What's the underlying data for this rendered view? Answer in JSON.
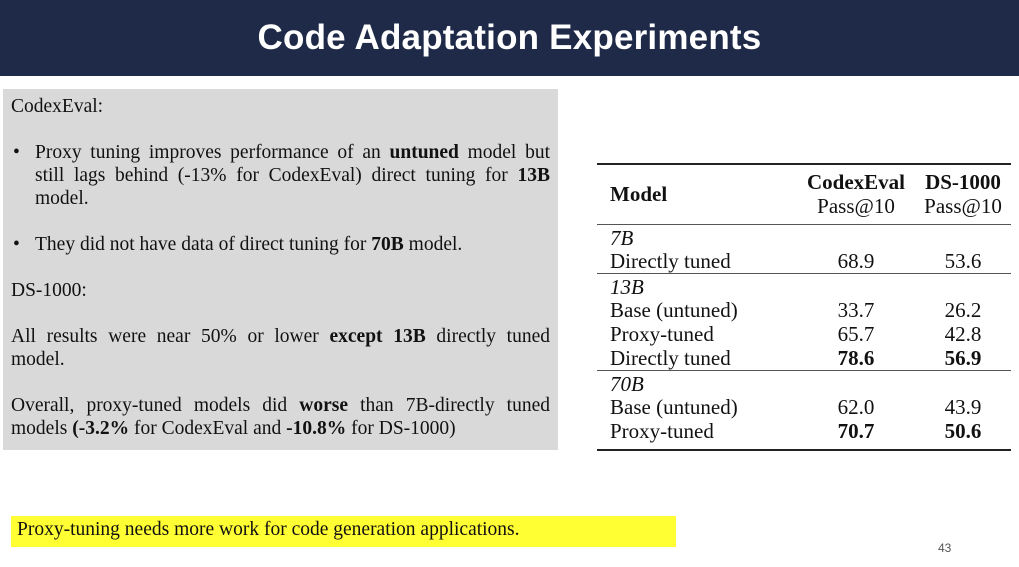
{
  "slide": {
    "title": "Code Adaptation Experiments",
    "page_number": "43"
  },
  "left_panel": {
    "codexeval_label": "CodexEval:",
    "bullet1": {
      "t1": "Proxy tuning improves performance of an ",
      "b1": "untuned",
      "t2": " model but still lags behind (-13% for CodexEval) direct tuning for ",
      "b2": "13B",
      "t3": " model."
    },
    "bullet2": {
      "t1": "They did not have data of direct tuning for ",
      "b1": "70B",
      "t2": " model."
    },
    "ds_label": "DS-1000:",
    "para1": {
      "t1": "All results were near 50% or lower ",
      "b1": "except 13B",
      "t2": " directly tuned model."
    },
    "para2": {
      "t1": "Overall, proxy-tuned models did ",
      "b1": "worse",
      "t2": " than 7B-directly tuned models ",
      "b2": "(-3.2%",
      "t3": " for CodexEval and ",
      "b3": "-10.8%",
      "t4": " for DS-1000)"
    }
  },
  "table": {
    "headers": {
      "model": "Model",
      "col1_name": "CodexEval",
      "col1_metric": "Pass@10",
      "col2_name": "DS-1000",
      "col2_metric": "Pass@10"
    },
    "groups": [
      {
        "name": "7B",
        "rows": [
          {
            "label": "Directly tuned",
            "codexeval": "68.9",
            "ds1000": "53.6"
          }
        ]
      },
      {
        "name": "13B",
        "rows": [
          {
            "label": "Base (untuned)",
            "codexeval": "33.7",
            "ds1000": "26.2"
          },
          {
            "label": "Proxy-tuned",
            "codexeval": "65.7",
            "ds1000": "42.8"
          },
          {
            "label": "Directly tuned",
            "codexeval": "78.6",
            "ds1000": "56.9"
          }
        ]
      },
      {
        "name": "70B",
        "rows": [
          {
            "label": "Base (untuned)",
            "codexeval": "62.0",
            "ds1000": "43.9"
          },
          {
            "label": "Proxy-tuned",
            "codexeval": "70.7",
            "ds1000": "50.6"
          }
        ]
      }
    ]
  },
  "note": "Proxy-tuning needs more work for code generation applications.",
  "colors": {
    "header_bg": "#1e2a47",
    "panel_bg": "#d9d9d9",
    "highlight": "#ffff33"
  }
}
